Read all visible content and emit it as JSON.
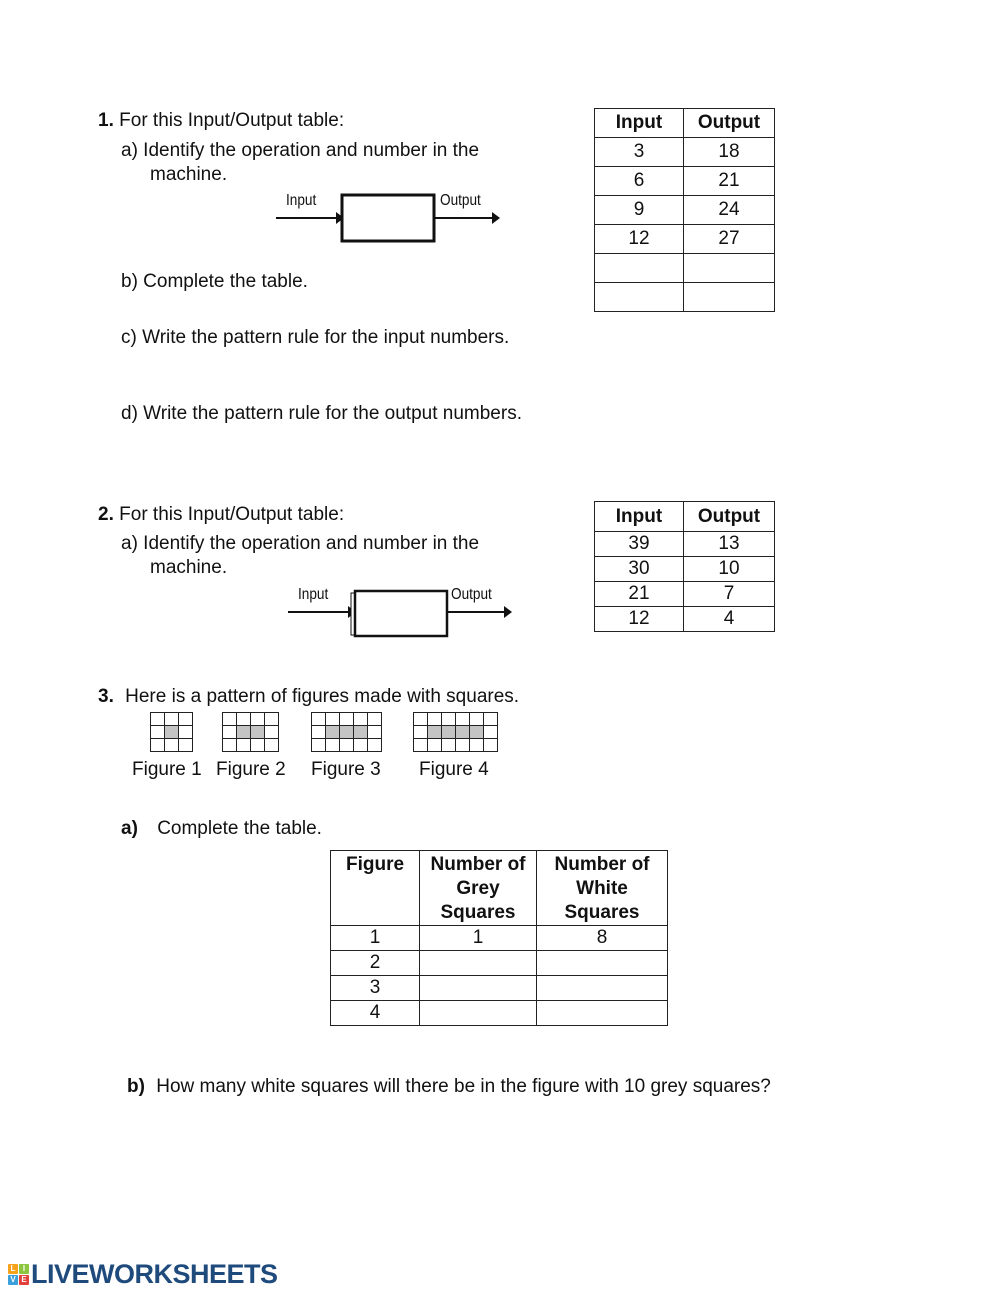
{
  "q1": {
    "number": "1.",
    "intro": "For this Input/Output table:",
    "a": "a)  Identify the operation and number in the",
    "a_cont": "machine.",
    "machine": {
      "input_label": "Input",
      "output_label": "Output"
    },
    "b": "b)  Complete the table.",
    "c": "c) Write the pattern rule for the input numbers.",
    "d": "d) Write the pattern rule for the output numbers.",
    "table": {
      "headers": [
        "Input",
        "Output"
      ],
      "rows": [
        [
          "3",
          "18"
        ],
        [
          "6",
          "21"
        ],
        [
          "9",
          "24"
        ],
        [
          "12",
          "27"
        ],
        [
          "",
          ""
        ],
        [
          "",
          ""
        ]
      ]
    }
  },
  "q2": {
    "number": "2.",
    "intro": "For this Input/Output table:",
    "a": "a) Identify the operation and number in the",
    "a_cont": "machine.",
    "machine": {
      "input_label": "Input",
      "output_label": "Output"
    },
    "table": {
      "headers": [
        "Input",
        "Output"
      ],
      "rows": [
        [
          "39",
          "13"
        ],
        [
          "30",
          "10"
        ],
        [
          "21",
          "7"
        ],
        [
          "12",
          "4"
        ]
      ]
    }
  },
  "q3": {
    "number": "3.",
    "intro": "Here is a pattern of figures made with squares.",
    "figures": [
      {
        "label": "Figure 1",
        "grey": 1
      },
      {
        "label": "Figure 2",
        "grey": 2
      },
      {
        "label": "Figure 3",
        "grey": 3
      },
      {
        "label": "Figure 4",
        "grey": 4
      }
    ],
    "a_label": "a)",
    "a_text": "Complete the table.",
    "table": {
      "headers": [
        "Figure",
        "Number of Grey Squares",
        "Number of White Squares"
      ],
      "rows": [
        [
          "1",
          "1",
          "8"
        ],
        [
          "2",
          "",
          ""
        ],
        [
          "3",
          "",
          ""
        ],
        [
          "4",
          "",
          ""
        ]
      ]
    },
    "b_label": "b)",
    "b_text": "How many white squares will there be in the figure with 10 grey squares?"
  },
  "footer": {
    "logo_text": "LIVEWORKSHEETS",
    "logo_letters": [
      "L",
      "I",
      "V",
      "E"
    ],
    "logo_colors": [
      "#f6a21c",
      "#8cc63f",
      "#3aa0dc",
      "#e2403a"
    ],
    "brand_color": "#1f4a7c"
  }
}
